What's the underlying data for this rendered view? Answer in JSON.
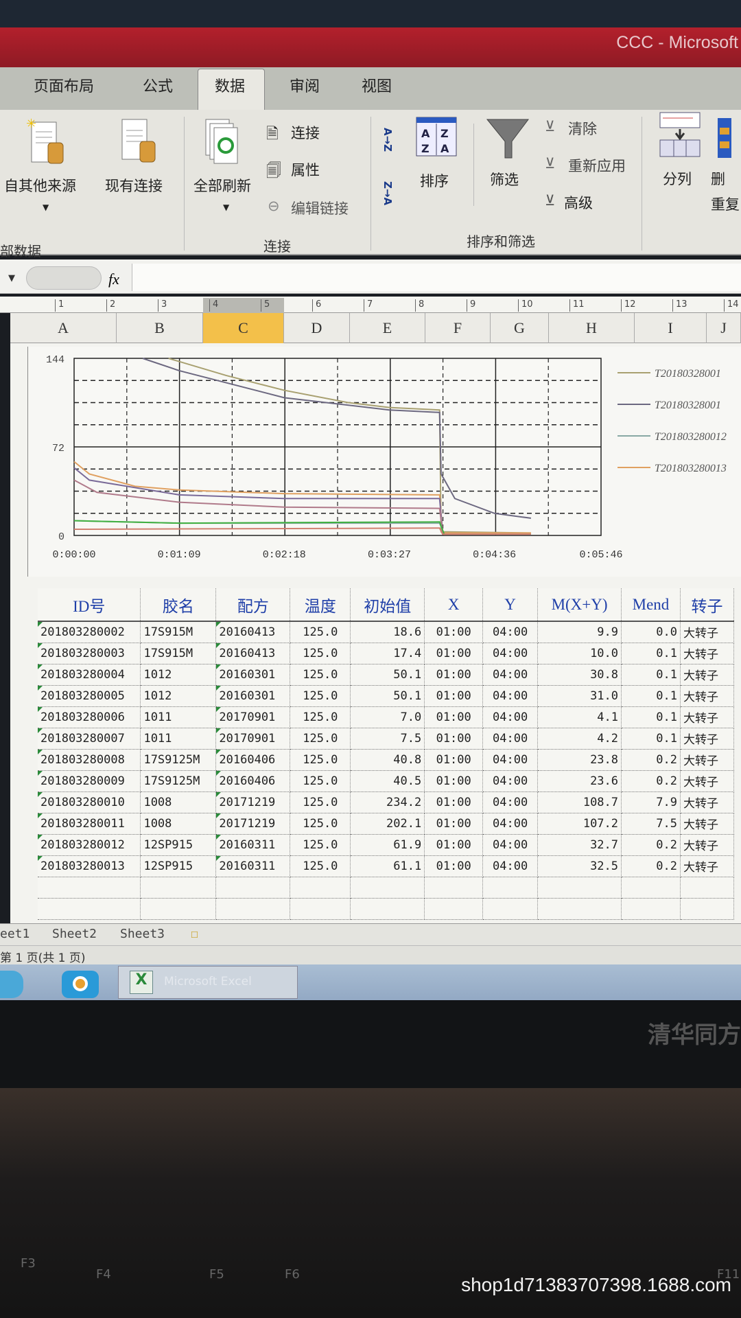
{
  "window": {
    "title": "CCC - Microsoft"
  },
  "ribbon": {
    "tabs": [
      "页面布局",
      "公式",
      "数据",
      "审阅",
      "视图"
    ],
    "active_tab": "数据",
    "get_external": {
      "from_other": "自其他来源",
      "existing": "现有连接",
      "group": "部数据"
    },
    "connections": {
      "refresh_all": "全部刷新",
      "connections": "连接",
      "properties": "属性",
      "edit_links": "编辑链接",
      "group": "连接"
    },
    "sort_filter": {
      "sort_az": "A→Z",
      "sort_za": "Z→A",
      "sort": "排序",
      "filter": "筛选",
      "clear": "清除",
      "reapply": "重新应用",
      "advanced": "高级",
      "group": "排序和筛选"
    },
    "data_tools": {
      "text_to_columns": "分列",
      "remove_dup_1": "删",
      "remove_dup_2": "重复"
    }
  },
  "formula_bar": {
    "fx": "fx",
    "value": ""
  },
  "ruler": [
    "1",
    "2",
    "3",
    "4",
    "5",
    "6",
    "7",
    "8",
    "9",
    "10",
    "11",
    "12",
    "13",
    "14"
  ],
  "columns": [
    "A",
    "B",
    "C",
    "D",
    "E",
    "F",
    "G",
    "H",
    "I",
    "J"
  ],
  "selected_column": "C",
  "chart_data": {
    "type": "line",
    "x_ticks": [
      "0:00:00",
      "0:01:09",
      "0:02:18",
      "0:03:27",
      "0:04:36",
      "0:05:46"
    ],
    "y_ticks": [
      "0",
      "72",
      "144"
    ],
    "ylim": [
      0,
      144
    ],
    "xlim": [
      "0:00:00",
      "0:05:46"
    ],
    "grid": true,
    "legend_position": "right",
    "series": [
      {
        "name": "T20180328001",
        "color": "#a8a070",
        "points": [
          [
            "0:01:02",
            144
          ],
          [
            "0:01:40",
            130
          ],
          [
            "0:02:18",
            118
          ],
          [
            "0:03:00",
            108
          ],
          [
            "0:03:27",
            104
          ],
          [
            "0:04:00",
            102
          ],
          [
            "0:04:01",
            3
          ],
          [
            "0:05:00",
            2
          ]
        ]
      },
      {
        "name": "T20180328001",
        "color": "#6c6880",
        "points": [
          [
            "0:00:45",
            144
          ],
          [
            "0:01:09",
            134
          ],
          [
            "0:02:18",
            112
          ],
          [
            "0:03:27",
            102
          ],
          [
            "0:04:00",
            100
          ],
          [
            "0:04:01",
            50
          ],
          [
            "0:04:10",
            30
          ],
          [
            "0:04:36",
            18
          ],
          [
            "0:05:00",
            14
          ]
        ]
      },
      {
        "name": "T201803280012",
        "color": "#88a8a4",
        "points": [
          [
            "0:00:00",
            12
          ],
          [
            "0:01:09",
            10
          ],
          [
            "0:04:00",
            10
          ],
          [
            "0:04:03",
            1
          ],
          [
            "0:05:00",
            1
          ]
        ]
      },
      {
        "name": "T201803280013",
        "color": "#e0a060",
        "points": [
          [
            "0:00:00",
            60
          ],
          [
            "0:00:10",
            50
          ],
          [
            "0:00:40",
            40
          ],
          [
            "0:01:09",
            37
          ],
          [
            "0:02:18",
            34
          ],
          [
            "0:04:00",
            33
          ],
          [
            "0:04:02",
            2
          ],
          [
            "0:05:00",
            2
          ]
        ]
      },
      {
        "color": "#7a6a98",
        "points": [
          [
            "0:00:00",
            55
          ],
          [
            "0:00:10",
            45
          ],
          [
            "0:01:09",
            33
          ],
          [
            "0:02:18",
            30
          ],
          [
            "0:04:00",
            30
          ],
          [
            "0:04:02",
            2
          ]
        ]
      },
      {
        "color": "#b07a8a",
        "points": [
          [
            "0:00:00",
            45
          ],
          [
            "0:00:15",
            35
          ],
          [
            "0:01:09",
            27
          ],
          [
            "0:02:18",
            23
          ],
          [
            "0:04:00",
            22
          ],
          [
            "0:04:02",
            2
          ]
        ]
      },
      {
        "color": "#40b040",
        "points": [
          [
            "0:00:00",
            12
          ],
          [
            "0:01:09",
            10
          ],
          [
            "0:04:00",
            11
          ],
          [
            "0:04:03",
            1
          ]
        ]
      },
      {
        "color": "#d08070",
        "points": [
          [
            "0:00:00",
            5
          ],
          [
            "0:04:00",
            6
          ],
          [
            "0:04:02",
            1
          ],
          [
            "0:05:00",
            1
          ]
        ]
      }
    ]
  },
  "table": {
    "headers": [
      "ID号",
      "胶名",
      "配方",
      "温度",
      "初始值",
      "X",
      "Y",
      "M(X+Y)",
      "Mend",
      "转子"
    ],
    "rows": [
      [
        "201803280002",
        "17S915M",
        "20160413",
        "125.0",
        "18.6",
        "01:00",
        "04:00",
        "9.9",
        "0.0",
        "大转子"
      ],
      [
        "201803280003",
        "17S915M",
        "20160413",
        "125.0",
        "17.4",
        "01:00",
        "04:00",
        "10.0",
        "0.1",
        "大转子"
      ],
      [
        "201803280004",
        "1012",
        "20160301",
        "125.0",
        "50.1",
        "01:00",
        "04:00",
        "30.8",
        "0.1",
        "大转子"
      ],
      [
        "201803280005",
        "1012",
        "20160301",
        "125.0",
        "50.1",
        "01:00",
        "04:00",
        "31.0",
        "0.1",
        "大转子"
      ],
      [
        "201803280006",
        "1011",
        "20170901",
        "125.0",
        "7.0",
        "01:00",
        "04:00",
        "4.1",
        "0.1",
        "大转子"
      ],
      [
        "201803280007",
        "1011",
        "20170901",
        "125.0",
        "7.5",
        "01:00",
        "04:00",
        "4.2",
        "0.1",
        "大转子"
      ],
      [
        "201803280008",
        "17S9125M",
        "20160406",
        "125.0",
        "40.8",
        "01:00",
        "04:00",
        "23.8",
        "0.2",
        "大转子"
      ],
      [
        "201803280009",
        "17S9125M",
        "20160406",
        "125.0",
        "40.5",
        "01:00",
        "04:00",
        "23.6",
        "0.2",
        "大转子"
      ],
      [
        "201803280010",
        "1008",
        "20171219",
        "125.0",
        "234.2",
        "01:00",
        "04:00",
        "108.7",
        "7.9",
        "大转子"
      ],
      [
        "201803280011",
        "1008",
        "20171219",
        "125.0",
        "202.1",
        "01:00",
        "04:00",
        "107.2",
        "7.5",
        "大转子"
      ],
      [
        "201803280012",
        "12SP915",
        "20160311",
        "125.0",
        "61.9",
        "01:00",
        "04:00",
        "32.7",
        "0.2",
        "大转子"
      ],
      [
        "201803280013",
        "12SP915",
        "20160311",
        "125.0",
        "61.1",
        "01:00",
        "04:00",
        "32.5",
        "0.2",
        "大转子"
      ]
    ]
  },
  "sheet_tabs": [
    "eet1",
    "Sheet2",
    "Sheet3"
  ],
  "status": {
    "page": "第 1 页(共 1 页)"
  },
  "taskbar": {
    "excel": "Microsoft Excel"
  },
  "monitor": {
    "brand": "清华同方"
  },
  "keyboard": {
    "keys": [
      "F3",
      "F4",
      "F5",
      "F6",
      "F11"
    ]
  },
  "watermark": "shop1d71383707398.1688.com"
}
